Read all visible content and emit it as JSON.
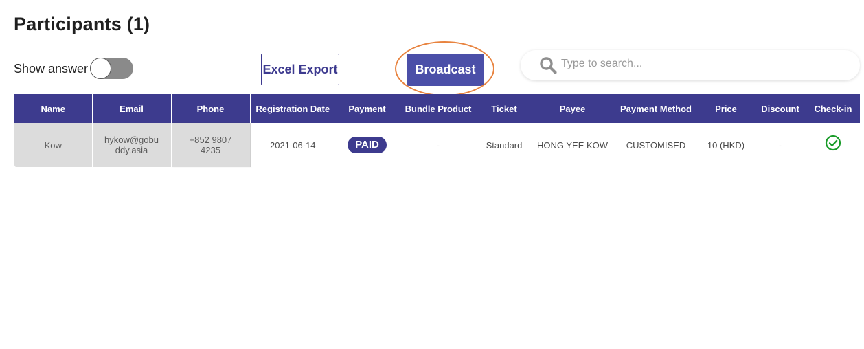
{
  "page": {
    "title": "Participants (1)"
  },
  "toolbar": {
    "show_answer_label": "Show answer",
    "show_answer_on": false,
    "excel_export_label": "Excel Export",
    "broadcast_label": "Broadcast",
    "search_placeholder": "Type to search...",
    "search_value": ""
  },
  "colors": {
    "brand": "#3d3b8e",
    "broadcast": "#4b4fa8",
    "highlight": "#e8833f",
    "checkin": "#1a9c2a",
    "sticky_cell_bg": "#dcdcdc"
  },
  "table": {
    "columns": [
      "Name",
      "Email",
      "Phone",
      "Registration Date",
      "Payment",
      "Bundle Product",
      "Ticket",
      "Payee",
      "Payment Method",
      "Price",
      "Discount",
      "Check-in"
    ],
    "rows": [
      {
        "name": "Kow",
        "email": "hykow@gobuddy.asia",
        "phone": "+852 9807 4235",
        "registration_date": "2021-06-14",
        "payment": "PAID",
        "bundle_product": "-",
        "ticket": "Standard",
        "payee": "HONG YEE KOW",
        "payment_method": "CUSTOMISED",
        "price": "10 (HKD)",
        "discount": "-",
        "checkin_icon": "check-circle-icon",
        "checked_in": true
      }
    ]
  }
}
